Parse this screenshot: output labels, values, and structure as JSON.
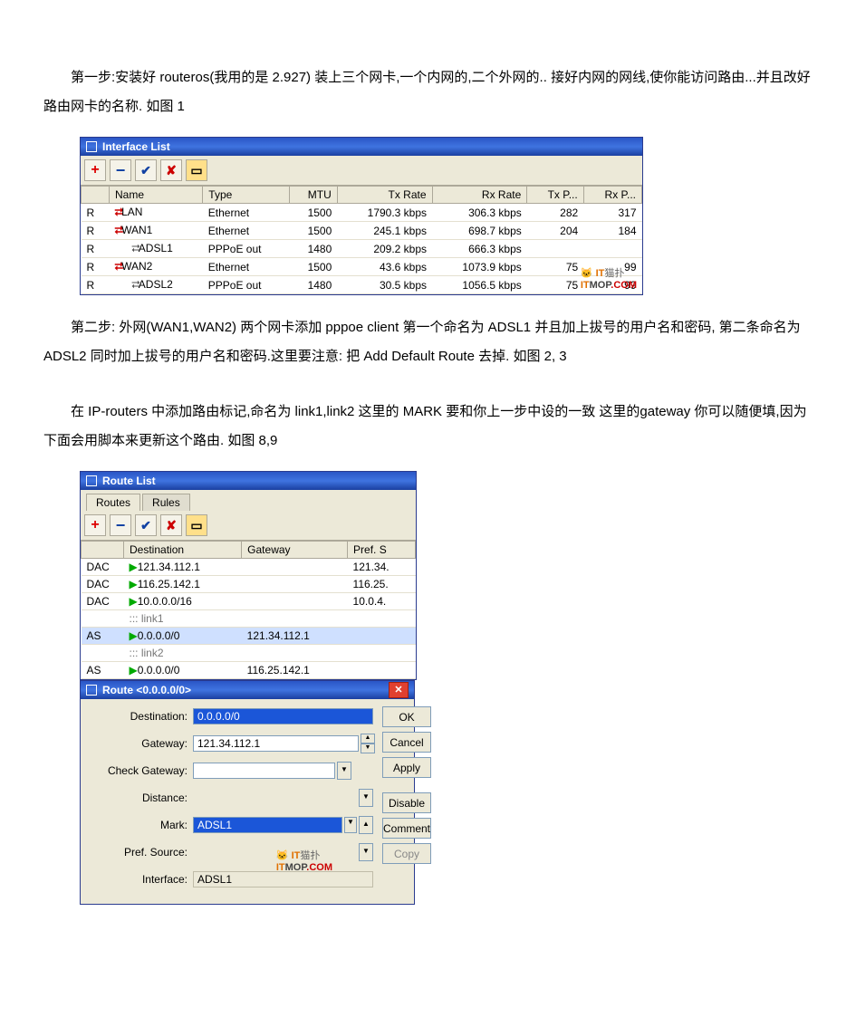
{
  "paragraphs": {
    "p1": "第一步:安装好 routeros(我用的是 2.927)  装上三个网卡,一个内网的,二个外网的..  接好内网的网线,使你能访问路由...并且改好路由网卡的名称.  如图 1",
    "p2": "第二步:  外网(WAN1,WAN2) 两个网卡添加 pppoe  client 第一个命名为 ADSL1  并且加上拔号的用户名和密码,  第二条命名为 ADSL2  同时加上拔号的用户名和密码.这里要注意:  把 Add  Default  Route  去掉.  如图  2, 3",
    "p3": "在 IP-routers 中添加路由标记,命名为 link1,link2 这里的 MARK 要和你上一步中设的一致  这里的gateway 你可以随便填,因为下面会用脚本来更新这个路由.  如图 8,9"
  },
  "interface_list": {
    "title": "Interface List",
    "columns": [
      "",
      "Name",
      "Type",
      "MTU",
      "Tx Rate",
      "Rx Rate",
      "Tx P...",
      "Rx P..."
    ],
    "rows": [
      {
        "flag": "R",
        "icon": "dual",
        "name": "LAN",
        "type": "Ethernet",
        "mtu": "1500",
        "tx": "1790.3 kbps",
        "rx": "306.3 kbps",
        "txp": "282",
        "rxp": "317"
      },
      {
        "flag": "R",
        "icon": "dual",
        "name": "WAN1",
        "type": "Ethernet",
        "mtu": "1500",
        "tx": "245.1 kbps",
        "rx": "698.7 kbps",
        "txp": "204",
        "rxp": "184"
      },
      {
        "flag": "R",
        "icon": "sub",
        "name": "ADSL1",
        "type": "PPPoE out",
        "mtu": "1480",
        "tx": "209.2 kbps",
        "rx": "666.3 kbps",
        "txp": "",
        "rxp": ""
      },
      {
        "flag": "R",
        "icon": "dual",
        "name": "WAN2",
        "type": "Ethernet",
        "mtu": "1500",
        "tx": "43.6 kbps",
        "rx": "1073.9 kbps",
        "txp": "75",
        "rxp": "99"
      },
      {
        "flag": "R",
        "icon": "sub",
        "name": "ADSL2",
        "type": "PPPoE out",
        "mtu": "1480",
        "tx": "30.5 kbps",
        "rx": "1056.5 kbps",
        "txp": "75",
        "rxp": "99"
      }
    ]
  },
  "route_list": {
    "title": "Route List",
    "tabs": [
      "Routes",
      "Rules"
    ],
    "columns": [
      "",
      "Destination",
      "Gateway",
      "Pref. S"
    ],
    "rows": [
      {
        "flag": "DAC",
        "kind": "row",
        "dest": "121.34.112.1",
        "gw": "",
        "pref": "121.34."
      },
      {
        "flag": "DAC",
        "kind": "row",
        "dest": "116.25.142.1",
        "gw": "",
        "pref": "116.25."
      },
      {
        "flag": "DAC",
        "kind": "row",
        "dest": "10.0.0.0/16",
        "gw": "",
        "pref": "10.0.4."
      },
      {
        "flag": "",
        "kind": "mark",
        "dest": "::: link1",
        "gw": "",
        "pref": ""
      },
      {
        "flag": "AS",
        "kind": "sel",
        "dest": "0.0.0.0/0",
        "gw": "121.34.112.1",
        "pref": ""
      },
      {
        "flag": "",
        "kind": "mark",
        "dest": "::: link2",
        "gw": "",
        "pref": ""
      },
      {
        "flag": "AS",
        "kind": "row",
        "dest": "0.0.0.0/0",
        "gw": "116.25.142.1",
        "pref": ""
      }
    ]
  },
  "route_dialog": {
    "title": "Route <0.0.0.0/0>",
    "fields": {
      "destination_label": "Destination:",
      "destination": "0.0.0.0/0",
      "gateway_label": "Gateway:",
      "gateway": "121.34.112.1",
      "check_gateway_label": "Check Gateway:",
      "check_gateway": "",
      "distance_label": "Distance:",
      "distance": "",
      "mark_label": "Mark:",
      "mark": "ADSL1",
      "pref_source_label": "Pref. Source:",
      "pref_source": "",
      "interface_label": "Interface:",
      "interface": "ADSL1"
    },
    "buttons": {
      "ok": "OK",
      "cancel": "Cancel",
      "apply": "Apply",
      "disable": "Disable",
      "comment": "Comment",
      "copy": "Copy"
    }
  },
  "watermark": {
    "brand": "IT",
    "text": "猫扑",
    "mop": "MOP",
    "com": ".COM",
    "prefix": "IT"
  }
}
